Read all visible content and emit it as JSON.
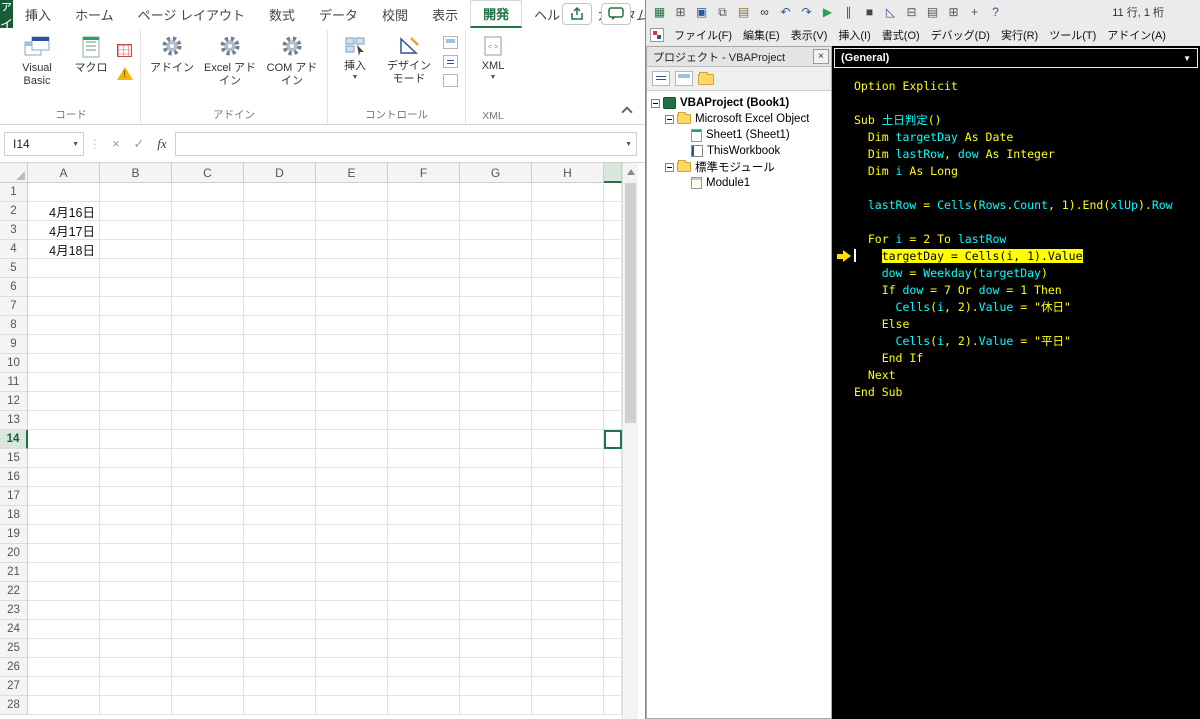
{
  "excel": {
    "tabs": {
      "file": "ファイル",
      "items": [
        "挿入",
        "ホーム",
        "ページ レイアウト",
        "数式",
        "データ",
        "校閲",
        "表示",
        "開発",
        "ヘルプ",
        "カスタム"
      ],
      "active": "開発"
    },
    "ribbon": {
      "code_group": {
        "label": "コード",
        "visual_basic": "Visual Basic",
        "macro": "マクロ"
      },
      "addins_group": {
        "label": "アドイン",
        "buttons": [
          "アドイン",
          "Excel アドイン",
          "COM アドイン"
        ]
      },
      "controls_group": {
        "label": "コントロール",
        "insert": "挿入",
        "design_mode": "デザイン モード"
      },
      "xml_group": {
        "label": "XML",
        "xml": "XML"
      }
    },
    "formula_bar": {
      "name_box": "I14",
      "cancel": "×",
      "enter": "✓",
      "fx": "fx"
    },
    "grid": {
      "columns": [
        "A",
        "B",
        "C",
        "D",
        "E",
        "F",
        "G",
        "H"
      ],
      "rows": 28,
      "cells": [
        {
          "row": 2,
          "col": "A",
          "value": "4月16日"
        },
        {
          "row": 3,
          "col": "A",
          "value": "4月17日"
        },
        {
          "row": 4,
          "col": "A",
          "value": "4月18日"
        }
      ],
      "selection": {
        "cell": "I14",
        "row": 14
      }
    }
  },
  "vbe": {
    "status": "11 行, 1 桁",
    "menus": [
      "ファイル(F)",
      "編集(E)",
      "表示(V)",
      "挿入(I)",
      "書式(O)",
      "デバッグ(D)",
      "実行(R)",
      "ツール(T)",
      "アドイン(A)"
    ],
    "toolbar_icons": [
      {
        "name": "excel-host-icon",
        "glyph": "▦",
        "color": "#1e7145"
      },
      {
        "name": "view-excel-icon",
        "glyph": "⊞",
        "color": "#555555"
      },
      {
        "name": "save-icon",
        "glyph": "▣",
        "color": "#2b579a"
      },
      {
        "name": "copy-icon",
        "glyph": "⧉",
        "color": "#555555"
      },
      {
        "name": "paste-icon",
        "glyph": "▤",
        "color": "#8a7040"
      },
      {
        "name": "find-icon",
        "glyph": "∞",
        "color": "#333333"
      },
      {
        "name": "undo-icon",
        "glyph": "↶",
        "color": "#2b579a"
      },
      {
        "name": "redo-icon",
        "glyph": "↷",
        "color": "#2b579a"
      },
      {
        "name": "run-icon",
        "glyph": "▶",
        "color": "#2e9e4f"
      },
      {
        "name": "break-icon",
        "glyph": "∥",
        "color": "#2b579a"
      },
      {
        "name": "reset-icon",
        "glyph": "■",
        "color": "#444444"
      },
      {
        "name": "design-mode-icon",
        "glyph": "◺",
        "color": "#2b579a"
      },
      {
        "name": "project-explorer-icon",
        "glyph": "⊟",
        "color": "#555555"
      },
      {
        "name": "properties-window-icon",
        "glyph": "▤",
        "color": "#555555"
      },
      {
        "name": "object-browser-icon",
        "glyph": "⊞",
        "color": "#555555"
      },
      {
        "name": "toolbox-icon",
        "glyph": "+",
        "color": "#555555"
      },
      {
        "name": "help-icon",
        "glyph": "?",
        "color": "#2b579a"
      }
    ],
    "project": {
      "title": "プロジェクト - VBAProject",
      "close": "×",
      "tree": [
        {
          "label": "VBAProject (Book1)",
          "level": 0,
          "icon": "project",
          "expander": true,
          "bold": true
        },
        {
          "label": "Microsoft Excel Object",
          "level": 1,
          "icon": "folder",
          "expander": true
        },
        {
          "label": "Sheet1 (Sheet1)",
          "level": 2,
          "icon": "worksheet"
        },
        {
          "label": "ThisWorkbook",
          "level": 2,
          "icon": "workbook"
        },
        {
          "label": "標準モジュール",
          "level": 1,
          "icon": "folder",
          "expander": true
        },
        {
          "label": "Module1",
          "level": 2,
          "icon": "module"
        }
      ]
    },
    "code": {
      "dropdown": "(General)",
      "lines": [
        {
          "tokens": [
            [
              "n",
              "Option Explicit"
            ]
          ]
        },
        {
          "tokens": []
        },
        {
          "tokens": [
            [
              "n",
              "Sub "
            ],
            [
              "id",
              "土日判定"
            ],
            [
              "n",
              "()"
            ]
          ]
        },
        {
          "tokens": [
            [
              "n",
              "  Dim "
            ],
            [
              "id",
              "targetDay"
            ],
            [
              "n",
              " As Date"
            ]
          ]
        },
        {
          "tokens": [
            [
              "n",
              "  Dim "
            ],
            [
              "id",
              "lastRow"
            ],
            [
              "n",
              ", "
            ],
            [
              "id",
              "dow"
            ],
            [
              "n",
              " As Integer"
            ]
          ]
        },
        {
          "tokens": [
            [
              "n",
              "  Dim "
            ],
            [
              "id",
              "i"
            ],
            [
              "n",
              " As Long"
            ]
          ]
        },
        {
          "tokens": []
        },
        {
          "tokens": [
            [
              "n",
              "  "
            ],
            [
              "id",
              "lastRow"
            ],
            [
              "n",
              " = "
            ],
            [
              "id",
              "Cells"
            ],
            [
              "n",
              "("
            ],
            [
              "id",
              "Rows"
            ],
            [
              "n",
              "."
            ],
            [
              "id",
              "Count"
            ],
            [
              "n",
              ", 1).End("
            ],
            [
              "id",
              "xlUp"
            ],
            [
              "n",
              ")."
            ],
            [
              "id",
              "Row"
            ]
          ]
        },
        {
          "tokens": []
        },
        {
          "tokens": [
            [
              "n",
              "  For "
            ],
            [
              "id",
              "i"
            ],
            [
              "n",
              " = 2 To "
            ],
            [
              "id",
              "lastRow"
            ]
          ]
        },
        {
          "cursor": true,
          "arrow": true,
          "tokens": [
            [
              "n",
              "    "
            ],
            [
              "hl",
              "targetDay = Cells(i, 1).Value"
            ]
          ]
        },
        {
          "tokens": [
            [
              "n",
              "    "
            ],
            [
              "id",
              "dow"
            ],
            [
              "n",
              " = "
            ],
            [
              "id",
              "Weekday"
            ],
            [
              "n",
              "("
            ],
            [
              "id",
              "targetDay"
            ],
            [
              "n",
              ")"
            ]
          ]
        },
        {
          "tokens": [
            [
              "n",
              "    If "
            ],
            [
              "id",
              "dow"
            ],
            [
              "n",
              " = 7 Or "
            ],
            [
              "id",
              "dow"
            ],
            [
              "n",
              " = 1 Then"
            ]
          ]
        },
        {
          "tokens": [
            [
              "n",
              "      "
            ],
            [
              "id",
              "Cells"
            ],
            [
              "n",
              "("
            ],
            [
              "id",
              "i"
            ],
            [
              "n",
              ", 2)."
            ],
            [
              "id",
              "Value"
            ],
            [
              "n",
              " = \"休日\""
            ]
          ]
        },
        {
          "tokens": [
            [
              "n",
              "    Else"
            ]
          ]
        },
        {
          "tokens": [
            [
              "n",
              "      "
            ],
            [
              "id",
              "Cells"
            ],
            [
              "n",
              "("
            ],
            [
              "id",
              "i"
            ],
            [
              "n",
              ", 2)."
            ],
            [
              "id",
              "Value"
            ],
            [
              "n",
              " = \"平日\""
            ]
          ]
        },
        {
          "tokens": [
            [
              "n",
              "    End If"
            ]
          ]
        },
        {
          "tokens": [
            [
              "n",
              "  Next"
            ]
          ]
        },
        {
          "tokens": [
            [
              "n",
              "End Sub"
            ]
          ]
        }
      ]
    }
  },
  "colors": {
    "accent_green": "#217346",
    "file_tab_green": "#185c37",
    "code_background": "#000000",
    "code_normal": "#ffff00",
    "code_identifier": "#00ffff",
    "execution_highlight": "#ffff00"
  }
}
